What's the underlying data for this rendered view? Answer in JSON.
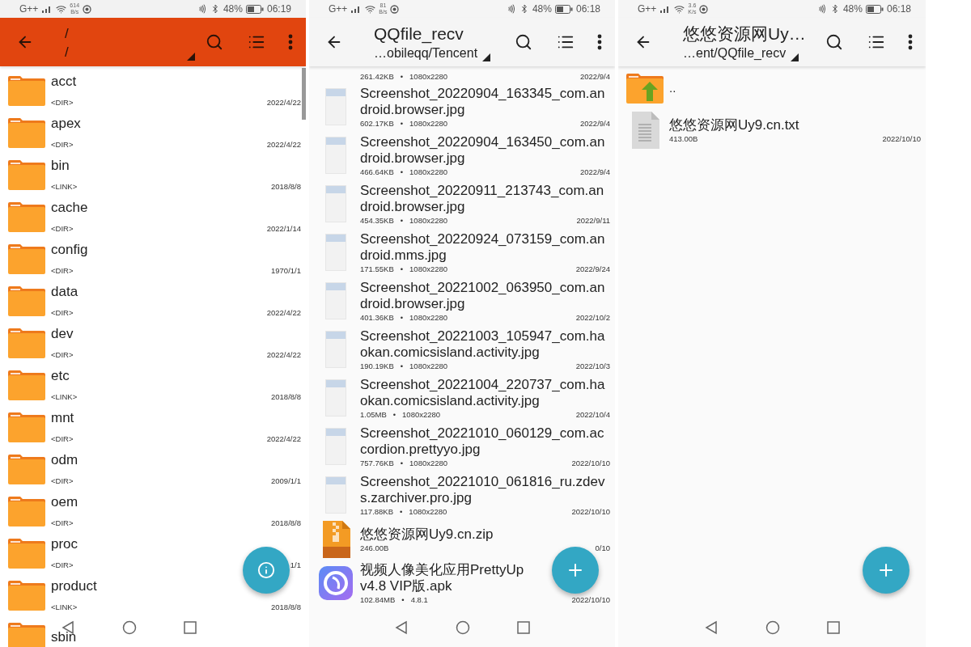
{
  "panels": [
    {
      "status_bar": {
        "network": "G++",
        "speed": "614",
        "speed_unit": "B/s",
        "battery": "48%",
        "time": "06:19"
      },
      "header": {
        "title": "/",
        "subtitle": "/"
      },
      "fab": {
        "kind": "info"
      },
      "items": [
        {
          "kind": "folder",
          "name": "acct",
          "type": "<DIR>",
          "date": "2022/4/22"
        },
        {
          "kind": "folder",
          "name": "apex",
          "type": "<DIR>",
          "date": "2022/4/22"
        },
        {
          "kind": "folder",
          "name": "bin",
          "type": "<LINK>",
          "date": "2018/8/8"
        },
        {
          "kind": "folder",
          "name": "cache",
          "type": "<DIR>",
          "date": "2022/1/14"
        },
        {
          "kind": "folder",
          "name": "config",
          "type": "<DIR>",
          "date": "1970/1/1"
        },
        {
          "kind": "folder",
          "name": "data",
          "type": "<DIR>",
          "date": "2022/4/22"
        },
        {
          "kind": "folder",
          "name": "dev",
          "type": "<DIR>",
          "date": "2022/4/22"
        },
        {
          "kind": "folder",
          "name": "etc",
          "type": "<LINK>",
          "date": "2018/8/8"
        },
        {
          "kind": "folder",
          "name": "mnt",
          "type": "<DIR>",
          "date": "2022/4/22"
        },
        {
          "kind": "folder",
          "name": "odm",
          "type": "<DIR>",
          "date": "2009/1/1"
        },
        {
          "kind": "folder",
          "name": "oem",
          "type": "<DIR>",
          "date": "2018/8/8"
        },
        {
          "kind": "folder",
          "name": "proc",
          "type": "<DIR>",
          "date": "1/1"
        },
        {
          "kind": "folder",
          "name": "product",
          "type": "<LINK>",
          "date": "2018/8/8"
        },
        {
          "kind": "folder",
          "name": "sbin"
        }
      ]
    },
    {
      "status_bar": {
        "network": "G++",
        "speed": "81",
        "speed_unit": "B/s",
        "battery": "48%",
        "time": "06:18"
      },
      "header": {
        "title": "QQfile_recv",
        "subtitle": "…obileqq/Tencent"
      },
      "fab": {
        "kind": "add"
      },
      "items": [
        {
          "kind": "meta",
          "size": "261.42KB",
          "separator": "•",
          "detail": "1080x2280",
          "date": "2022/9/4"
        },
        {
          "kind": "image",
          "name": "Screenshot_20220904_163345_com.android.browser.jpg",
          "size": "602.17KB",
          "separator": "•",
          "detail": "1080x2280",
          "date": "2022/9/4"
        },
        {
          "kind": "image",
          "name": "Screenshot_20220904_163450_com.android.browser.jpg",
          "size": "466.64KB",
          "separator": "•",
          "detail": "1080x2280",
          "date": "2022/9/4"
        },
        {
          "kind": "image",
          "name": "Screenshot_20220911_213743_com.android.browser.jpg",
          "size": "454.35KB",
          "separator": "•",
          "detail": "1080x2280",
          "date": "2022/9/11"
        },
        {
          "kind": "image",
          "name": "Screenshot_20220924_073159_com.android.mms.jpg",
          "size": "171.55KB",
          "separator": "•",
          "detail": "1080x2280",
          "date": "2022/9/24"
        },
        {
          "kind": "image",
          "name": "Screenshot_20221002_063950_com.android.browser.jpg",
          "size": "401.36KB",
          "separator": "•",
          "detail": "1080x2280",
          "date": "2022/10/2"
        },
        {
          "kind": "image",
          "name": "Screenshot_20221003_105947_com.haokan.comicsisland.activity.jpg",
          "size": "190.19KB",
          "separator": "•",
          "detail": "1080x2280",
          "date": "2022/10/3"
        },
        {
          "kind": "image",
          "name": "Screenshot_20221004_220737_com.haokan.comicsisland.activity.jpg",
          "size": "1.05MB",
          "separator": "•",
          "detail": "1080x2280",
          "date": "2022/10/4"
        },
        {
          "kind": "image",
          "name": "Screenshot_20221010_060129_com.accordion.prettyyo.jpg",
          "size": "757.76KB",
          "separator": "•",
          "detail": "1080x2280",
          "date": "2022/10/10"
        },
        {
          "kind": "image",
          "name": "Screenshot_20221010_061816_ru.zdevs.zarchiver.pro.jpg",
          "size": "117.88KB",
          "separator": "•",
          "detail": "1080x2280",
          "date": "2022/10/10"
        },
        {
          "kind": "zip",
          "name": "悠悠资源网Uy9.cn.zip",
          "size": "246.00B",
          "date": "0/10"
        },
        {
          "kind": "apk",
          "name": "视频人像美化应用PrettyUp v4.8 VIP版.apk",
          "size": "102.84MB",
          "separator": "•",
          "detail": "4.8.1",
          "date": "2022/10/10"
        }
      ]
    },
    {
      "status_bar": {
        "network": "G++",
        "speed": "3.6",
        "speed_unit": "K/s",
        "battery": "48%",
        "time": "06:18"
      },
      "header": {
        "title": "悠悠资源网Uy…",
        "subtitle": "…ent/QQfile_recv"
      },
      "fab": {
        "kind": "add"
      },
      "items": [
        {
          "kind": "up",
          "name": ".."
        },
        {
          "kind": "text",
          "name": "悠悠资源网Uy9.cn.txt",
          "size": "413.00B",
          "date": "2022/10/10"
        }
      ]
    }
  ]
}
